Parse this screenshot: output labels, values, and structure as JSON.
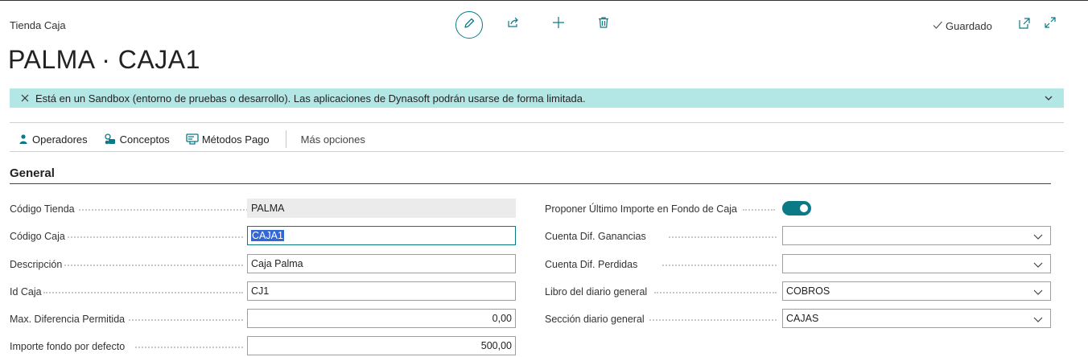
{
  "header": {
    "breadcrumb": "Tienda Caja",
    "title": "PALMA · CAJA1",
    "status": "Guardado"
  },
  "banner": {
    "message": "Está en un Sandbox (entorno de pruebas o desarrollo). Las aplicaciones de Dynasoft podrán usarse de forma limitada."
  },
  "actions": {
    "operadores": "Operadores",
    "conceptos": "Conceptos",
    "metodos_pago": "Métodos Pago",
    "mas_opciones": "Más opciones"
  },
  "section": {
    "title": "General"
  },
  "left_fields": [
    {
      "label": "Código Tienda",
      "value": "PALMA"
    },
    {
      "label": "Código Caja",
      "value": "CAJA1"
    },
    {
      "label": "Descripción",
      "value": "Caja Palma"
    },
    {
      "label": "Id Caja",
      "value": "CJ1"
    },
    {
      "label": "Max. Diferencia Permitida",
      "value": "0,00"
    },
    {
      "label": "Importe fondo por defecto",
      "value": "500,00"
    }
  ],
  "right_fields": [
    {
      "label": "Proponer Último Importe en Fondo de Caja",
      "value": "on"
    },
    {
      "label": "Cuenta Dif. Ganancias",
      "value": ""
    },
    {
      "label": "Cuenta Dif. Perdidas",
      "value": ""
    },
    {
      "label": "Libro del diario general",
      "value": "COBROS"
    },
    {
      "label": "Sección diario general",
      "value": "CAJAS"
    }
  ],
  "colors": {
    "accent": "#0a7a86",
    "banner_bg": "#b3e7e5",
    "readonly_bg": "#ebebeb",
    "selection": "#3367d6"
  }
}
